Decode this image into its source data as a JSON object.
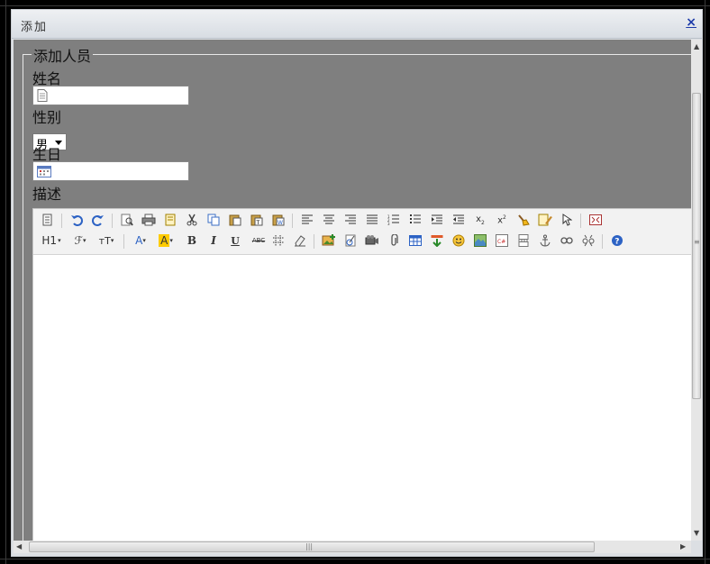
{
  "dialog": {
    "title": "添加",
    "close_label": "×"
  },
  "form": {
    "legend": "添加人员",
    "name_label": "姓名",
    "name_value": "",
    "gender_label": "性别",
    "gender_value": "男",
    "birthday_label": "生日",
    "birthday_value": "",
    "description_label": "描述"
  },
  "toolbar": {
    "row1": [
      "source",
      "undo",
      "redo",
      "preview",
      "print",
      "template",
      "cut",
      "copy",
      "paste",
      "paste-plain",
      "paste-word",
      "align-left",
      "align-center",
      "align-right",
      "justify",
      "ordered-list",
      "unordered-list",
      "indent",
      "outdent",
      "subscript",
      "superscript",
      "clear-format",
      "select-all-edit",
      "select",
      "fullscreen"
    ],
    "heading_label": "H1",
    "font_label": "ℱ",
    "size_label": "тT",
    "font_color_label": "A",
    "highlight_label": "A",
    "bold_label": "B",
    "italic_label": "I",
    "underline_label": "U",
    "strike_label": "ABC"
  },
  "colors": {
    "overlay": "#7f7f7f",
    "accent": "#1c3aa9",
    "highlight": "#ffcc00"
  }
}
